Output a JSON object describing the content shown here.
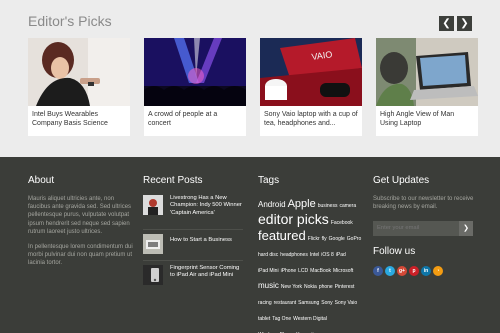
{
  "editors_picks": {
    "title": "Editor's Picks",
    "prev_icon": "chevron-left-icon",
    "next_icon": "chevron-right-icon",
    "cards": [
      {
        "caption": "Intel Buys Wearables Company Basis Science"
      },
      {
        "caption": "A crowd of people at a concert"
      },
      {
        "caption": "Sony Vaio laptop with a cup of tea, headphones and..."
      },
      {
        "caption": "High Angle View of Man Using Laptop"
      }
    ],
    "vaio_text": "VAIO"
  },
  "about": {
    "title": "About",
    "paragraphs": [
      "Mauris aliquet ultricies ante, non faucibus ante gravida sed. Sed ultrices pellentesque purus, vulputate volutpat ipsum hendrerit sed neque sed sapien rutrum laoreet justo ultrices.",
      "In pellentesque lorem condimentum dui morbi pulvinar dui non quam pretium ut lacinia tortor."
    ]
  },
  "recent_posts": {
    "title": "Recent Posts",
    "posts": [
      {
        "title": "Livestrong Has a New Champion: Indy 500 Winner 'Captain America'"
      },
      {
        "title": "How to Start a Business"
      },
      {
        "title": "Fingerprint Sensor Coming to iPad Air and iPad Mini"
      }
    ]
  },
  "tags": {
    "title": "Tags",
    "items": [
      {
        "label": "Android",
        "size": 8
      },
      {
        "label": "Apple",
        "size": 11
      },
      {
        "label": "business",
        "size": 5
      },
      {
        "label": "camera",
        "size": 5
      },
      {
        "label": "editor picks",
        "size": 14
      },
      {
        "label": "Facebook",
        "size": 5
      },
      {
        "label": "featured",
        "size": 13
      },
      {
        "label": "Flickr",
        "size": 5
      },
      {
        "label": "fly",
        "size": 5
      },
      {
        "label": "Google",
        "size": 5
      },
      {
        "label": "GoPro",
        "size": 5
      },
      {
        "label": "hard disc",
        "size": 5
      },
      {
        "label": "headphones",
        "size": 5
      },
      {
        "label": "Intel",
        "size": 5
      },
      {
        "label": "iOS 8",
        "size": 5
      },
      {
        "label": "iPad",
        "size": 5
      },
      {
        "label": "iPad Mini",
        "size": 5
      },
      {
        "label": "iPhone",
        "size": 5
      },
      {
        "label": "LCD",
        "size": 5
      },
      {
        "label": "MacBook",
        "size": 5
      },
      {
        "label": "Microsoft",
        "size": 5
      },
      {
        "label": "music",
        "size": 8
      },
      {
        "label": "New York",
        "size": 5
      },
      {
        "label": "Nokia",
        "size": 5
      },
      {
        "label": "phone",
        "size": 5
      },
      {
        "label": "Pinterest",
        "size": 5
      },
      {
        "label": "racing",
        "size": 5
      },
      {
        "label": "restaurant",
        "size": 5
      },
      {
        "label": "Samsung",
        "size": 5
      },
      {
        "label": "Sony",
        "size": 5
      },
      {
        "label": "Sony Vaio",
        "size": 5
      },
      {
        "label": "tablet",
        "size": 5
      },
      {
        "label": "Tag One",
        "size": 5
      },
      {
        "label": "Western Digital",
        "size": 5
      },
      {
        "label": "Windows Phone",
        "size": 5
      },
      {
        "label": "Yosemite",
        "size": 5
      }
    ]
  },
  "updates": {
    "title": "Get Updates",
    "text": "Subscribe to our newsletter to receive breaking news by email.",
    "email_placeholder": "Enter your email",
    "submit_icon": "chevron-right-icon",
    "follow_title": "Follow us",
    "social": [
      {
        "name": "facebook-icon",
        "glyph": "f",
        "color": "#3b5998"
      },
      {
        "name": "twitter-icon",
        "glyph": "t",
        "color": "#2aa9e0"
      },
      {
        "name": "google-plus-icon",
        "glyph": "g+",
        "color": "#d34836"
      },
      {
        "name": "pinterest-icon",
        "glyph": "p",
        "color": "#cb2027"
      },
      {
        "name": "linkedin-icon",
        "glyph": "in",
        "color": "#0e76a8"
      },
      {
        "name": "rss-icon",
        "glyph": "◔",
        "color": "#f39c12"
      }
    ]
  }
}
